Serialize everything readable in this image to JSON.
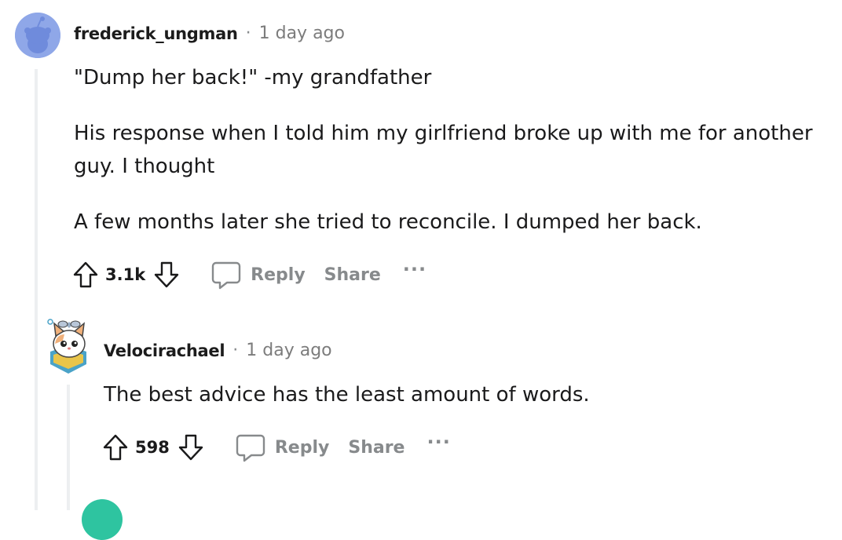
{
  "comments": [
    {
      "author": "frederick_ungman",
      "separator": "·",
      "time": "1 day ago",
      "paragraphs": [
        "\"Dump her back!\" -my grandfather",
        "His response when I told him my girlfriend broke up with me for another guy. I thought",
        "A few months later she tried to reconcile. I dumped her back."
      ],
      "score": "3.1k",
      "reply_label": "Reply",
      "share_label": "Share",
      "more_label": "···"
    },
    {
      "author": "Velocirachael",
      "separator": "·",
      "time": "1 day ago",
      "paragraphs": [
        "The best advice has the least amount of words."
      ],
      "score": "598",
      "reply_label": "Reply",
      "share_label": "Share",
      "more_label": "···"
    }
  ],
  "icons": {
    "upvote": "arrow-up-outline-icon",
    "downvote": "arrow-down-outline-icon",
    "reply": "speech-bubble-icon",
    "more": "ellipsis-icon"
  },
  "colors": {
    "meta_gray": "#878a8c",
    "thread_line": "#edeff1",
    "avatar_blue": "#8fa7e8",
    "avatar_teal": "#2ec4a0"
  }
}
